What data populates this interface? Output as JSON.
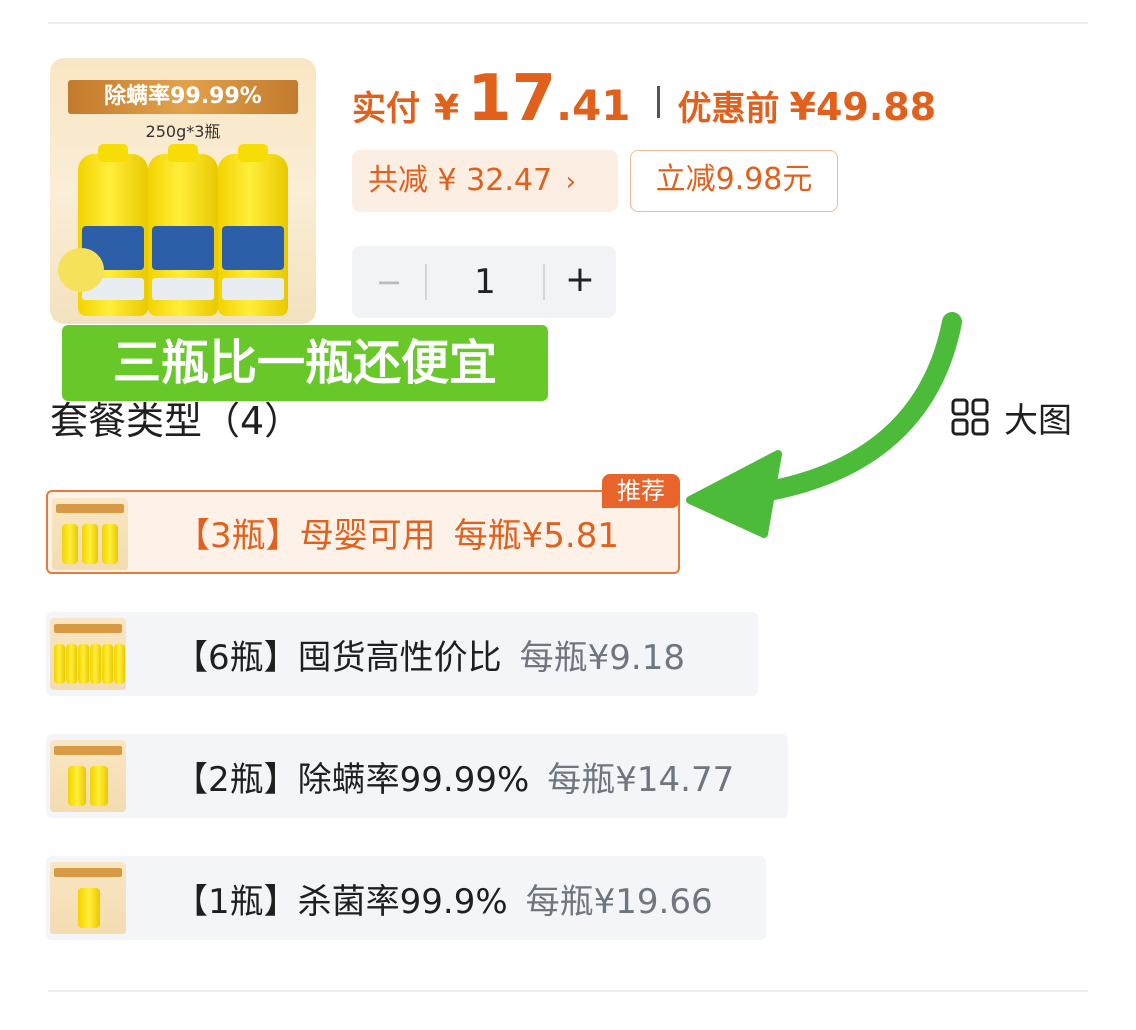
{
  "product": {
    "image_ribbon": "除螨率99.99%",
    "image_spec": "250g*3瓶",
    "paid_label": "实付",
    "currency": "¥",
    "price_int": "17",
    "price_dec": ".41",
    "orig_label": "优惠前",
    "orig_price": "¥49.88"
  },
  "discounts": {
    "total": "共减 ¥ 32.47",
    "total_arrow": "›",
    "instant": "立减9.98元"
  },
  "quantity": {
    "minus": "−",
    "value": "1",
    "plus": "+"
  },
  "banner": "三瓶比一瓶还便宜",
  "packages_section": {
    "title": "套餐类型（4）",
    "big_view": "大图",
    "recommend_badge": "推荐",
    "items": [
      {
        "name": "【3瓶】母婴可用",
        "per": "每瓶¥5.81",
        "selected": true
      },
      {
        "name": "【6瓶】囤货高性价比",
        "per": "每瓶¥9.18",
        "selected": false
      },
      {
        "name": "【2瓶】除螨率99.99%",
        "per": "每瓶¥14.77",
        "selected": false
      },
      {
        "name": "【1瓶】杀菌率99.9%",
        "per": "每瓶¥19.66",
        "selected": false
      }
    ]
  },
  "colors": {
    "accent": "#e0601c",
    "banner": "#68c82a",
    "arrow": "#4cbb3a"
  }
}
